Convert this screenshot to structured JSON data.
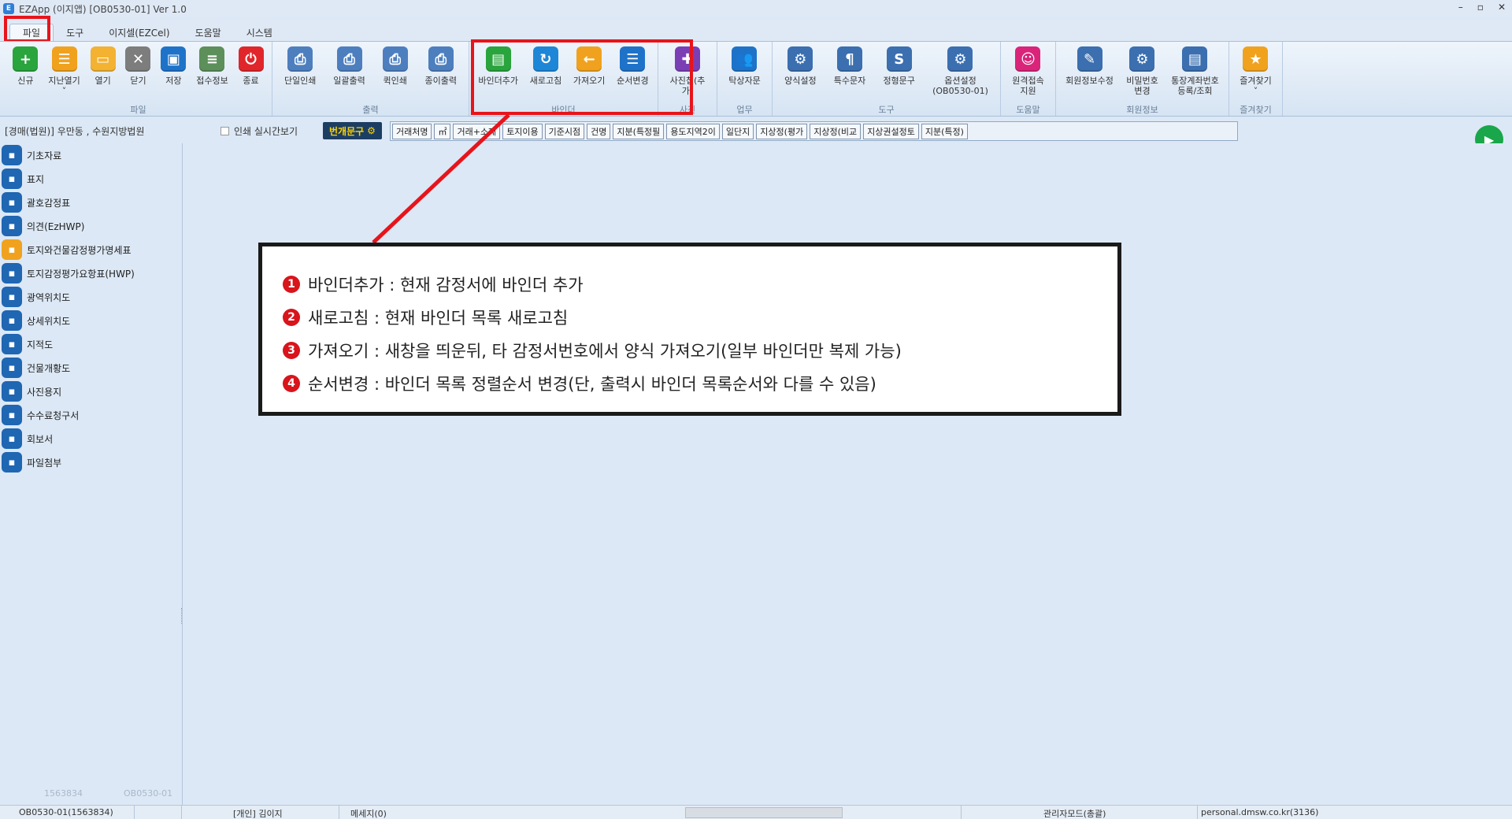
{
  "titlebar": {
    "title": "EZApp (이지앱) [OB0530-01] Ver 1.0",
    "icon": "app-logo-icon",
    "win_min": "–",
    "win_max": "▫",
    "win_close": "✕"
  },
  "menu": {
    "tabs": [
      "파일",
      "도구",
      "이지셀(EZCel)",
      "도움말",
      "시스템"
    ]
  },
  "ribbon": {
    "groups": [
      {
        "label": "파일",
        "buttons": [
          {
            "label": "신규",
            "icon": "plus-icon",
            "color": "#2aa43c",
            "glyph": "+"
          },
          {
            "label": "지난열기\n˅",
            "icon": "folder-history-icon",
            "color": "#f0a21e",
            "glyph": "☰"
          },
          {
            "label": "열기",
            "icon": "folder-open-icon",
            "color": "#f3b232",
            "glyph": "▭"
          },
          {
            "label": "닫기",
            "icon": "close-icon",
            "color": "#7d7d7d",
            "glyph": "✕"
          },
          {
            "label": "저장",
            "icon": "save-icon",
            "color": "#1e73c9",
            "glyph": "▣"
          },
          {
            "label": "접수정보",
            "icon": "receipt-icon",
            "color": "#5c8f5a",
            "glyph": "≡"
          },
          {
            "label": "종료",
            "icon": "power-icon",
            "color": "#e0262b",
            "glyph": "⏻"
          }
        ]
      },
      {
        "label": "출력",
        "buttons": [
          {
            "label": "단일인쇄",
            "icon": "print-single-icon",
            "color": "#4d7fbf",
            "glyph": "⎙"
          },
          {
            "label": "일괄출력",
            "icon": "print-all-icon",
            "color": "#4d7fbf",
            "glyph": "⎙"
          },
          {
            "label": "퀵인쇄",
            "icon": "print-quick-icon",
            "color": "#4d7fbf",
            "glyph": "⎙"
          },
          {
            "label": "종이출력",
            "icon": "print-paper-icon",
            "color": "#4d7fbf",
            "glyph": "⎙"
          }
        ]
      },
      {
        "label": "바인더",
        "buttons": [
          {
            "label": "바인더추가",
            "icon": "binder-add-icon",
            "color": "#2aa43c",
            "glyph": "▤"
          },
          {
            "label": "새로고침",
            "icon": "refresh-icon",
            "color": "#1e86d6",
            "glyph": "↻"
          },
          {
            "label": "가져오기",
            "icon": "import-arrow-icon",
            "color": "#f0a21e",
            "glyph": "←"
          },
          {
            "label": "순서변경",
            "icon": "reorder-icon",
            "color": "#1e73c9",
            "glyph": "☰"
          }
        ]
      },
      {
        "label": "사진",
        "buttons": [
          {
            "label": "사진첩(추가)",
            "icon": "photo-album-icon",
            "color": "#7b3fb5",
            "glyph": "✚"
          }
        ]
      },
      {
        "label": "업무",
        "buttons": [
          {
            "label": "탁상자문",
            "icon": "consult-icon",
            "color": "#1e73c9",
            "glyph": "👥"
          }
        ]
      },
      {
        "label": "도구",
        "buttons": [
          {
            "label": "양식설정",
            "icon": "form-settings-icon",
            "color": "#3b6fb0",
            "glyph": "⚙"
          },
          {
            "label": "특수문자",
            "icon": "special-char-icon",
            "color": "#3b6fb0",
            "glyph": "¶"
          },
          {
            "label": "정형문구",
            "icon": "fixed-phrase-icon",
            "color": "#3b6fb0",
            "glyph": "S"
          },
          {
            "label": "옵션설정\n(OB0530-01)",
            "icon": "user-settings-icon",
            "color": "#3b6fb0",
            "glyph": "⚙"
          }
        ]
      },
      {
        "label": "도움말",
        "buttons": [
          {
            "label": "원격접속\n지원",
            "icon": "remote-support-icon",
            "color": "#d9247a",
            "glyph": "☺"
          }
        ]
      },
      {
        "label": "회원정보",
        "buttons": [
          {
            "label": "회원정보수정",
            "icon": "member-edit-icon",
            "color": "#3b6fb0",
            "glyph": "✎"
          },
          {
            "label": "비밀번호\n변경",
            "icon": "password-icon",
            "color": "#3b6fb0",
            "glyph": "⚙"
          },
          {
            "label": "통장계좌번호\n등록/조회",
            "icon": "bank-account-icon",
            "color": "#3b6fb0",
            "glyph": "▤"
          }
        ]
      },
      {
        "label": "즐겨찾기",
        "buttons": [
          {
            "label": "즐겨찾기\n˅",
            "icon": "star-icon",
            "color": "#f0a21e",
            "glyph": "★"
          }
        ]
      }
    ]
  },
  "subbar": {
    "court": "[경매(법원)] 우만동 , 수원지방법원",
    "print_preview": "인쇄 실시간보기",
    "phrase_button": "번개문구",
    "chips": [
      "거래처명",
      "㎡",
      "거래+소재",
      "토지이용",
      "기준시점",
      "건명",
      "지분(특정필",
      "용도지역2이",
      "일단지",
      "지상정(평가",
      "지상정(비교",
      "지상권설정토",
      "지분(특정)"
    ]
  },
  "sidebar": {
    "items": [
      {
        "label": "기초자료",
        "icon": "layers-icon"
      },
      {
        "label": "표지",
        "icon": "document-icon"
      },
      {
        "label": "괄호감정표",
        "icon": "pin-list-icon"
      },
      {
        "label": "의견(EzHWP)",
        "icon": "stack-icon"
      },
      {
        "label": "토지와건물감정평가명세표",
        "icon": "map-orange-icon"
      },
      {
        "label": "토지감정평가요항표(HWP)",
        "icon": "map-icon"
      },
      {
        "label": "광역위치도",
        "icon": "location-pin-icon"
      },
      {
        "label": "상세위치도",
        "icon": "location-detail-icon"
      },
      {
        "label": "지적도",
        "icon": "globe-icon"
      },
      {
        "label": "건물개황도",
        "icon": "globe-building-icon"
      },
      {
        "label": "사진용지",
        "icon": "photo-icon"
      },
      {
        "label": "수수료청구서",
        "icon": "invoice-icon"
      },
      {
        "label": "회보서",
        "icon": "clipboard-icon"
      },
      {
        "label": "파일첨부",
        "icon": "paperclip-icon"
      }
    ],
    "footer_left": "1563834",
    "footer_right": "OB0530-01"
  },
  "callout": {
    "lines": [
      {
        "num": "1",
        "text": "바인더추가 : 현재 감정서에 바인더 추가"
      },
      {
        "num": "2",
        "text": "새로고침 : 현재 바인더 목록 새로고침"
      },
      {
        "num": "3",
        "text": "가져오기 : 새창을 띄운뒤, 타 감정서번호에서 양식 가져오기(일부 바인더만 복제 가능)"
      },
      {
        "num": "4",
        "text": "순서변경 : 바인더 목록 정렬순서 변경(단, 출력시 바인더 목록순서와 다를 수 있음)"
      }
    ]
  },
  "statusbar": {
    "id": "OB0530-01(1563834)",
    "user": "[개인] 김이지",
    "message": "메세지(0)",
    "mode": "관리자모드(총괄)",
    "site": "personal.dmsw.co.kr(3136)"
  },
  "colors": {
    "highlight": "#e8141b",
    "run_button": "#1aa64a",
    "phrase_button_bg": "#1d3e63"
  }
}
